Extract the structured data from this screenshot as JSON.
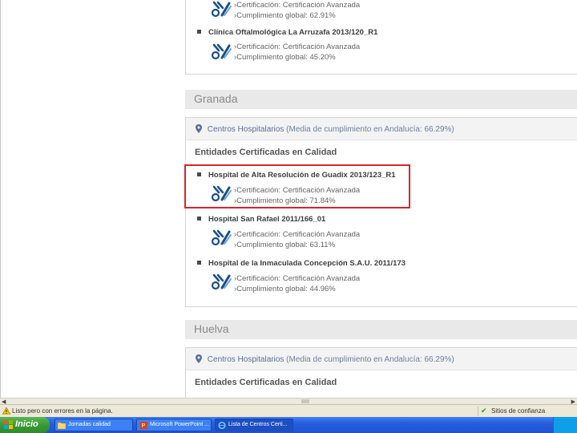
{
  "top_partial": {
    "item1": {
      "certificacion": "›Certificación: Certificación Avanzada",
      "cumplimiento": "›Cumplimiento global: 62.91%"
    },
    "item2": {
      "title": "Clínica Oftalmológica La Arruzafa 2013/120_R1",
      "certificacion": "›Certificación: Certificación Avanzada",
      "cumplimiento": "›Cumplimiento global: 45.20%"
    }
  },
  "granada": {
    "header": "Granada",
    "centros_link": "Centros Hospitalarios",
    "centros_media": "(Media de cumplimiento en Andalucía: 66.29%)",
    "entidades": "Entidades Certificadas en Calidad",
    "items": [
      {
        "title": "Hospital de Alta Resolución de Guadix 2013/123_R1",
        "certificacion": "›Certificación: Certificación Avanzada",
        "cumplimiento": "›Cumplimiento global: 71.84%"
      },
      {
        "title": "Hospital San Rafael 2011/166_01",
        "certificacion": "›Certificación: Certificación Avanzada",
        "cumplimiento": "›Cumplimiento global: 63.11%"
      },
      {
        "title": "Hospital de la Inmaculada Concepción S.A.U. 2011/173",
        "certificacion": "›Certificación: Certificación Avanzada",
        "cumplimiento": "›Cumplimiento global: 44.96%"
      }
    ]
  },
  "huelva": {
    "header": "Huelva",
    "centros_link": "Centros Hospitalarios",
    "centros_media": "(Media de cumplimiento en Andalucía: 66.29%)",
    "entidades": "Entidades Certificadas en Calidad"
  },
  "status_bar": {
    "text": "Listo pero con errores en la página.",
    "zone": "Sitios de confianza"
  },
  "taskbar": {
    "start": "Inicio",
    "tasks": [
      "Jornadas calidad",
      "Microsoft PowerPoint ...",
      "Lista de Centros Certi..."
    ]
  },
  "colors": {
    "highlight": "#d8242c",
    "link": "#5a6f9e",
    "taskbar": "#245edb",
    "start": "#3a9a36"
  },
  "icons": {
    "certification": "certification-badge-icon",
    "location": "location-pin-icon",
    "start": "windows-flag-icon"
  }
}
